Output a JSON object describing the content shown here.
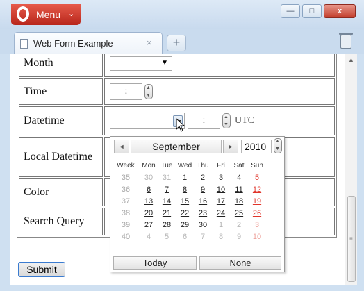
{
  "window": {
    "menu_label": "Menu",
    "caret": "⌄",
    "min": "—",
    "max": "□",
    "close": "x",
    "tab_title": "Web Form Example",
    "tab_close": "×",
    "new_tab": "+"
  },
  "form": {
    "rows": {
      "month": "Month",
      "time": "Time",
      "datetime": "Datetime",
      "local_datetime": "Local Datetime",
      "color": "Color",
      "search": "Search Query"
    },
    "time_value": ":",
    "datetime_time_value": ":",
    "utc_label": "UTC",
    "submit_label": "Submit"
  },
  "calendar": {
    "month": "September",
    "year": "2010",
    "prev": "◄",
    "next": "►",
    "week_header": "Week",
    "day_headers": [
      "Mon",
      "Tue",
      "Wed",
      "Thu",
      "Fri",
      "Sat",
      "Sun"
    ],
    "weeks": [
      {
        "week": "35",
        "days": [
          "30",
          "31",
          "1",
          "2",
          "3",
          "4",
          "5"
        ]
      },
      {
        "week": "36",
        "days": [
          "6",
          "7",
          "8",
          "9",
          "10",
          "11",
          "12"
        ]
      },
      {
        "week": "37",
        "days": [
          "13",
          "14",
          "15",
          "16",
          "17",
          "18",
          "19"
        ]
      },
      {
        "week": "38",
        "days": [
          "20",
          "21",
          "22",
          "23",
          "24",
          "25",
          "26"
        ]
      },
      {
        "week": "39",
        "days": [
          "27",
          "28",
          "29",
          "30",
          "1",
          "2",
          "3"
        ]
      },
      {
        "week": "40",
        "days": [
          "4",
          "5",
          "6",
          "7",
          "8",
          "9",
          "10"
        ]
      }
    ],
    "today_label": "Today",
    "none_label": "None"
  },
  "colors": {
    "sunday": "#e0342a",
    "menu_red": "#c9372a",
    "focus_border": "#3a7bd0"
  }
}
